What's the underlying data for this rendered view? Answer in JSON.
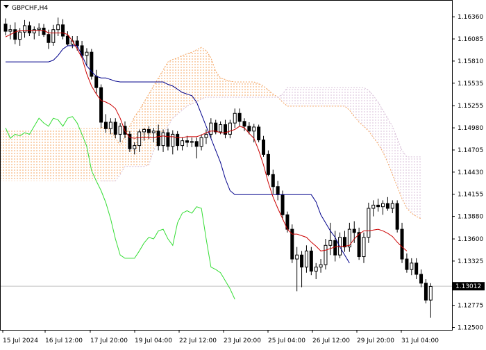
{
  "header": {
    "symbol_label": "GBPCHF,H4",
    "dropdown_icon": "triangle-down-icon"
  },
  "colors": {
    "background": "#ffffff",
    "frame": "#000000",
    "tenkan": "#cc0000",
    "kijun": "#00008b",
    "chikou": "#33dd33",
    "senkou_a": "#f4a460",
    "senkou_b": "#d8bfd8",
    "candle_bull": "#ffffff",
    "candle_bear": "#000000",
    "current_price_line": "#c0c0c0",
    "current_price_box": "#000000",
    "current_price_text": "#ffffff"
  },
  "chart_data": {
    "type": "candlestick",
    "symbol": "GBPCHF",
    "timeframe": "H4",
    "y_ticks": [
      "1.16360",
      "1.16085",
      "1.15810",
      "1.15535",
      "1.15255",
      "1.14980",
      "1.14705",
      "1.14430",
      "1.14155",
      "1.13880",
      "1.13600",
      "1.13325",
      "1.12775",
      "1.12500"
    ],
    "y_range": [
      1.1247,
      1.1656
    ],
    "current_price": "1.13012",
    "x_labels": [
      "15 Jul 2024",
      "16 Jul 12:00",
      "17 Jul 20:00",
      "19 Jul 04:00",
      "22 Jul 12:00",
      "23 Jul 20:00",
      "25 Jul 04:00",
      "26 Jul 12:00",
      "29 Jul 20:00",
      "31 Jul 04:00"
    ],
    "candles": [
      [
        1.1627,
        1.1634,
        1.1613,
        1.1618
      ],
      [
        1.1618,
        1.1626,
        1.1608,
        1.162
      ],
      [
        1.162,
        1.1629,
        1.1602,
        1.1608
      ],
      [
        1.1608,
        1.1622,
        1.16,
        1.1617
      ],
      [
        1.1617,
        1.1632,
        1.161,
        1.1625
      ],
      [
        1.1625,
        1.163,
        1.1612,
        1.1616
      ],
      [
        1.1616,
        1.1624,
        1.1608,
        1.162
      ],
      [
        1.162,
        1.1628,
        1.1612,
        1.1622
      ],
      [
        1.1622,
        1.1627,
        1.1611,
        1.1614
      ],
      [
        1.1614,
        1.162,
        1.1596,
        1.1604
      ],
      [
        1.1604,
        1.1626,
        1.16,
        1.162
      ],
      [
        1.162,
        1.1635,
        1.1612,
        1.1626
      ],
      [
        1.1626,
        1.1633,
        1.1608,
        1.1612
      ],
      [
        1.1612,
        1.1618,
        1.16,
        1.1602
      ],
      [
        1.1602,
        1.1612,
        1.1597,
        1.1606
      ],
      [
        1.1606,
        1.1612,
        1.1594,
        1.16
      ],
      [
        1.16,
        1.1606,
        1.1585,
        1.1588
      ],
      [
        1.1588,
        1.1597,
        1.1575,
        1.1592
      ],
      [
        1.1592,
        1.1596,
        1.1558,
        1.1562
      ],
      [
        1.1562,
        1.157,
        1.154,
        1.1548
      ],
      [
        1.1548,
        1.1552,
        1.1498,
        1.1505
      ],
      [
        1.1505,
        1.1515,
        1.1492,
        1.1497
      ],
      [
        1.1497,
        1.151,
        1.149,
        1.1505
      ],
      [
        1.1505,
        1.151,
        1.1485,
        1.149
      ],
      [
        1.149,
        1.1504,
        1.148,
        1.15
      ],
      [
        1.15,
        1.1506,
        1.1485,
        1.149
      ],
      [
        1.149,
        1.1494,
        1.1468,
        1.1472
      ],
      [
        1.1472,
        1.148,
        1.1465,
        1.1476
      ],
      [
        1.1476,
        1.1496,
        1.1468,
        1.1493
      ],
      [
        1.1493,
        1.1498,
        1.1482,
        1.1496
      ],
      [
        1.1496,
        1.15,
        1.1484,
        1.1492
      ],
      [
        1.1492,
        1.1498,
        1.148,
        1.1494
      ],
      [
        1.1494,
        1.1502,
        1.147,
        1.1476
      ],
      [
        1.1476,
        1.1496,
        1.1468,
        1.1492
      ],
      [
        1.1492,
        1.1497,
        1.147,
        1.1475
      ],
      [
        1.1475,
        1.1495,
        1.1465,
        1.149
      ],
      [
        1.149,
        1.1494,
        1.147,
        1.1476
      ],
      [
        1.1476,
        1.1486,
        1.147,
        1.1482
      ],
      [
        1.1482,
        1.1488,
        1.1474,
        1.148
      ],
      [
        1.148,
        1.1486,
        1.1474,
        1.1481
      ],
      [
        1.1481,
        1.1486,
        1.146,
        1.1475
      ],
      [
        1.1475,
        1.149,
        1.147,
        1.1486
      ],
      [
        1.1486,
        1.1496,
        1.1478,
        1.149
      ],
      [
        1.149,
        1.151,
        1.1485,
        1.1504
      ],
      [
        1.1504,
        1.1508,
        1.149,
        1.1493
      ],
      [
        1.1493,
        1.1506,
        1.149,
        1.1502
      ],
      [
        1.1502,
        1.1508,
        1.1485,
        1.149
      ],
      [
        1.149,
        1.1508,
        1.1485,
        1.1504
      ],
      [
        1.1504,
        1.1522,
        1.1498,
        1.1516
      ],
      [
        1.1516,
        1.1522,
        1.15,
        1.1506
      ],
      [
        1.1506,
        1.151,
        1.1494,
        1.15
      ],
      [
        1.15,
        1.1505,
        1.149,
        1.1494
      ],
      [
        1.1494,
        1.1503,
        1.148,
        1.1499
      ],
      [
        1.1499,
        1.1502,
        1.148,
        1.1483
      ],
      [
        1.1483,
        1.1488,
        1.1462,
        1.1465
      ],
      [
        1.1465,
        1.147,
        1.1438,
        1.144
      ],
      [
        1.144,
        1.1446,
        1.1416,
        1.1425
      ],
      [
        1.1425,
        1.1432,
        1.1408,
        1.1415
      ],
      [
        1.1415,
        1.142,
        1.1384,
        1.139
      ],
      [
        1.139,
        1.1394,
        1.1368,
        1.1372
      ],
      [
        1.1372,
        1.1378,
        1.133,
        1.1335
      ],
      [
        1.1335,
        1.135,
        1.1295,
        1.134
      ],
      [
        1.134,
        1.1345,
        1.13,
        1.1325
      ],
      [
        1.1325,
        1.1352,
        1.1318,
        1.1345
      ],
      [
        1.1345,
        1.135,
        1.1315,
        1.132
      ],
      [
        1.132,
        1.133,
        1.131,
        1.1325
      ],
      [
        1.1325,
        1.1335,
        1.1318,
        1.1328
      ],
      [
        1.1328,
        1.136,
        1.1322,
        1.1352
      ],
      [
        1.1352,
        1.138,
        1.134,
        1.1358
      ],
      [
        1.1358,
        1.137,
        1.1332,
        1.134
      ],
      [
        1.134,
        1.1368,
        1.1336,
        1.1362
      ],
      [
        1.1362,
        1.137,
        1.1344,
        1.135
      ],
      [
        1.135,
        1.138,
        1.1344,
        1.1372
      ],
      [
        1.1372,
        1.1382,
        1.1355,
        1.1368
      ],
      [
        1.1368,
        1.1374,
        1.1334,
        1.1338
      ],
      [
        1.1338,
        1.1368,
        1.133,
        1.1362
      ],
      [
        1.1362,
        1.1405,
        1.1355,
        1.1398
      ],
      [
        1.1398,
        1.1408,
        1.1388,
        1.1402
      ],
      [
        1.1402,
        1.141,
        1.1394,
        1.14
      ],
      [
        1.14,
        1.1408,
        1.139,
        1.1404
      ],
      [
        1.1404,
        1.1412,
        1.1395,
        1.1398
      ],
      [
        1.1398,
        1.1408,
        1.1392,
        1.1404
      ],
      [
        1.1404,
        1.1408,
        1.1368,
        1.1372
      ],
      [
        1.1372,
        1.138,
        1.133,
        1.1335
      ],
      [
        1.1335,
        1.1342,
        1.1318,
        1.1322
      ],
      [
        1.1322,
        1.1336,
        1.1315,
        1.133
      ],
      [
        1.133,
        1.1336,
        1.131,
        1.1316
      ],
      [
        1.1316,
        1.1322,
        1.13,
        1.1305
      ],
      [
        1.1305,
        1.131,
        1.128,
        1.1284
      ],
      [
        1.1284,
        1.1305,
        1.1262,
        1.1301
      ]
    ],
    "tenkan": [
      1.1611,
      1.1614,
      1.1617,
      1.1619,
      1.1619,
      1.1619,
      1.1619,
      1.1619,
      1.1619,
      1.1616,
      1.1616,
      1.1616,
      1.1616,
      1.1614,
      1.1606,
      1.1596,
      1.1585,
      1.1565,
      1.155,
      1.154,
      1.1532,
      1.153,
      1.1527,
      1.1522,
      1.151,
      1.1494,
      1.1486,
      1.1485,
      1.1486,
      1.1486,
      1.1486,
      1.1486,
      1.1487,
      1.1488,
      1.1487,
      1.1487,
      1.1486,
      1.1486,
      1.1487,
      1.1487,
      1.1487,
      1.1489,
      1.1492,
      1.1494,
      1.1494,
      1.1492,
      1.1492,
      1.1494,
      1.1496,
      1.15,
      1.1498,
      1.1491,
      1.1485,
      1.147,
      1.1452,
      1.143,
      1.1412,
      1.1398,
      1.1385,
      1.1372,
      1.1366,
      1.1366,
      1.1364,
      1.1362,
      1.1356,
      1.1351,
      1.1345,
      1.1346,
      1.1348,
      1.135,
      1.1351,
      1.1351,
      1.1352,
      1.136,
      1.1366,
      1.137,
      1.137,
      1.1371,
      1.1372,
      1.137,
      1.1367,
      1.1363,
      1.1356,
      1.135,
      1.1345
    ],
    "kijun": [
      1.158,
      1.158,
      1.158,
      1.158,
      1.158,
      1.158,
      1.158,
      1.158,
      1.158,
      1.158,
      1.1582,
      1.1588,
      1.1596,
      1.16,
      1.16,
      1.16,
      1.1588,
      1.1575,
      1.1568,
      1.1562,
      1.156,
      1.156,
      1.1558,
      1.1556,
      1.1555,
      1.1555,
      1.1555,
      1.1555,
      1.1555,
      1.1555,
      1.1555,
      1.1555,
      1.1555,
      1.1555,
      1.1552,
      1.155,
      1.1546,
      1.1542,
      1.154,
      1.1538,
      1.153,
      1.1515,
      1.15,
      1.1485,
      1.147,
      1.1455,
      1.1435,
      1.142,
      1.1415,
      1.1415,
      1.1415,
      1.1415,
      1.1415,
      1.1415,
      1.1415,
      1.1415,
      1.1415,
      1.1415,
      1.1415,
      1.1415,
      1.1415,
      1.1415,
      1.1415,
      1.1415,
      1.1415,
      1.1406,
      1.139,
      1.138,
      1.137,
      1.1362,
      1.135,
      1.134,
      1.133
    ],
    "senkou_a": [
      1.1498,
      1.15,
      1.1494,
      1.1486,
      1.1476,
      1.1488,
      1.15,
      1.1512,
      1.152,
      1.153,
      1.154,
      1.155,
      1.156,
      1.157,
      1.158,
      1.1583,
      1.1585,
      1.1588,
      1.159,
      1.1592,
      1.1595,
      1.1598,
      1.1594,
      1.1585,
      1.1568,
      1.156,
      1.1558,
      1.1556,
      1.1555,
      1.1555,
      1.1555,
      1.1555,
      1.1555,
      1.1553,
      1.155,
      1.1545,
      1.154,
      1.1536,
      1.153,
      1.1525,
      1.1525,
      1.1525,
      1.1525,
      1.1525,
      1.1525,
      1.1525,
      1.1525,
      1.1525,
      1.1525,
      1.1525,
      1.1525,
      1.1525,
      1.152,
      1.1512,
      1.1505,
      1.15,
      1.1494,
      1.1486,
      1.1478,
      1.1468,
      1.1455,
      1.144,
      1.1425,
      1.141,
      1.1398,
      1.1392,
      1.1388,
      1.1385
    ],
    "senkou_b": [
      1.1432,
      1.1432,
      1.1432,
      1.1432,
      1.144,
      1.145,
      1.145,
      1.145,
      1.145,
      1.145,
      1.1452,
      1.147,
      1.148,
      1.149,
      1.15,
      1.151,
      1.1515,
      1.152,
      1.1525,
      1.1528,
      1.153,
      1.1534,
      1.1536,
      1.1536,
      1.1536,
      1.1536,
      1.1536,
      1.1536,
      1.1536,
      1.1536,
      1.1536,
      1.1536,
      1.1536,
      1.1536,
      1.1536,
      1.1536,
      1.1536,
      1.1536,
      1.154,
      1.1548,
      1.1548,
      1.1548,
      1.1548,
      1.1548,
      1.1548,
      1.1548,
      1.1548,
      1.1548,
      1.1548,
      1.1548,
      1.1548,
      1.1548,
      1.1548,
      1.1548,
      1.1548,
      1.1548,
      1.1545,
      1.1538,
      1.153,
      1.152,
      1.151,
      1.15,
      1.1485,
      1.147,
      1.1462,
      1.1462,
      1.1462,
      1.1462
    ],
    "chikou": [
      1.1498,
      1.1485,
      1.149,
      1.1488,
      1.1492,
      1.149,
      1.15,
      1.151,
      1.1504,
      1.15,
      1.151,
      1.1508,
      1.15,
      1.151,
      1.1512,
      1.1504,
      1.149,
      1.1475,
      1.1445,
      1.1432,
      1.142,
      1.1405,
      1.1385,
      1.136,
      1.134,
      1.1336,
      1.1336,
      1.1336,
      1.1345,
      1.1355,
      1.1362,
      1.136,
      1.137,
      1.1372,
      1.136,
      1.1352,
      1.138,
      1.1392,
      1.1395,
      1.1392,
      1.14,
      1.1398,
      1.136,
      1.1325,
      1.1322,
      1.1318,
      1.1308,
      1.1298,
      1.1285
    ]
  }
}
